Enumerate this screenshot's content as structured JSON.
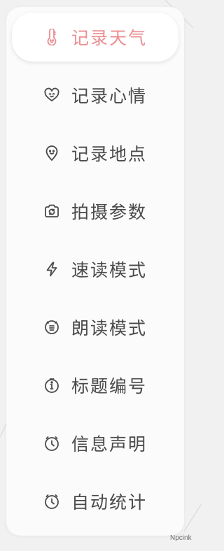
{
  "menu": {
    "items": [
      {
        "label": "记录天气",
        "icon": "thermometer-face-icon",
        "active": true
      },
      {
        "label": "记录心情",
        "icon": "heart-face-icon",
        "active": false
      },
      {
        "label": "记录地点",
        "icon": "location-pin-face-icon",
        "active": false
      },
      {
        "label": "拍摄参数",
        "icon": "camera-icon",
        "active": false
      },
      {
        "label": "速读模式",
        "icon": "lightning-icon",
        "active": false
      },
      {
        "label": "朗读模式",
        "icon": "speak-face-icon",
        "active": false
      },
      {
        "label": "标题编号",
        "icon": "info-badge-icon",
        "active": false
      },
      {
        "label": "信息声明",
        "icon": "timer-icon",
        "active": false
      },
      {
        "label": "自动统计",
        "icon": "timer-icon",
        "active": false
      }
    ]
  },
  "colors": {
    "active_text": "#eb8e92",
    "text": "#4a4a4a",
    "panel": "#fbfbfb",
    "background": "#f1f1f1"
  },
  "watermark": "Npcink"
}
